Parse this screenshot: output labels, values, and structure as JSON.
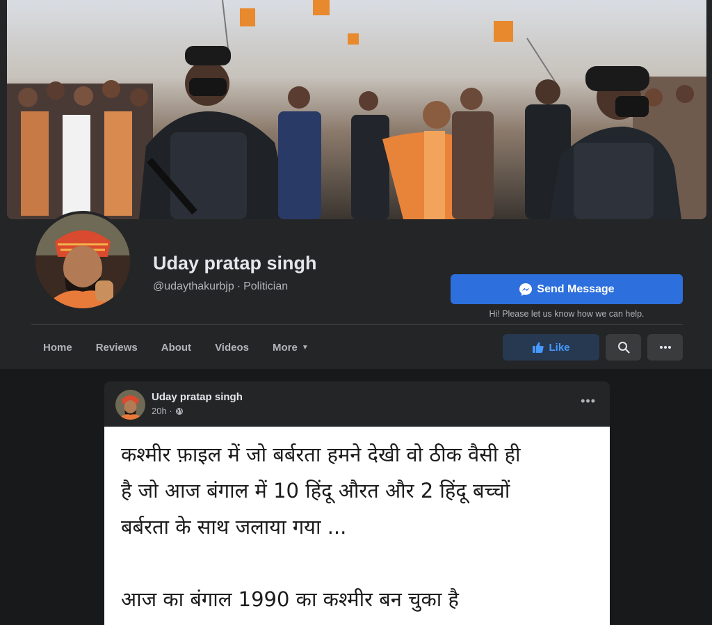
{
  "profile": {
    "name": "Uday pratap singh",
    "handle": "@udaythakurbjp",
    "category": "Politician"
  },
  "actions": {
    "send_message": "Send Message",
    "help_text": "Hi! Please let us know how we can help.",
    "like": "Like"
  },
  "nav": {
    "items": [
      {
        "label": "Home"
      },
      {
        "label": "Reviews"
      },
      {
        "label": "About"
      },
      {
        "label": "Videos"
      },
      {
        "label": "More"
      }
    ]
  },
  "post": {
    "author": "Uday pratap singh",
    "time": "20h",
    "image_text": {
      "line1": "कश्मीर फ़ाइल में जो बर्बरता हमने देखी वो ठीक वैसी ही",
      "line2": "है जो आज बंगाल में 10 हिंदू औरत और 2 हिंदू बच्चों",
      "line3": "बर्बरता के साथ जलाया गया ...",
      "line4": "आज का बंगाल 1990 का कश्मीर बन चुका है"
    }
  },
  "icons": {
    "messenger": "messenger-icon",
    "like": "thumbs-up-icon",
    "search": "search-icon",
    "more": "more-horizontal-icon",
    "globe": "globe-icon",
    "caret": "caret-down-icon"
  },
  "colors": {
    "accent": "#2d6fdc",
    "like_text": "#4599ff",
    "background": "#18191a",
    "surface": "#242526"
  }
}
